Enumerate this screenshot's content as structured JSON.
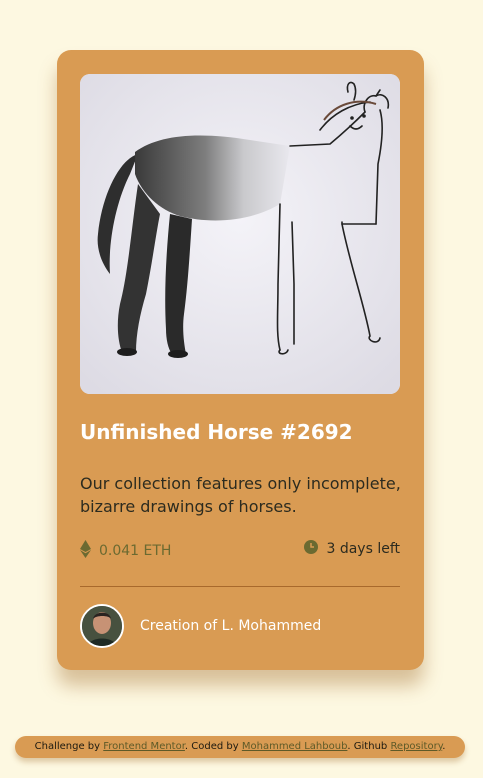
{
  "card": {
    "image_alt": "Unfinished horse drawing",
    "title": "Unfinished Horse #2692",
    "description": "Our collection features only incomplete, bizarre drawings of horses.",
    "price": "0.041 ETH",
    "time_left": "3 days left",
    "creator_prefix": "Creation of ",
    "creator_name": "L. Mohammed"
  },
  "icons": {
    "price": "ethereum-icon",
    "time": "clock-icon"
  },
  "attribution": {
    "text1": "Challenge by ",
    "link1": "Frontend Mentor",
    "text2": ". Coded by ",
    "link2": "Mohammed Lahboub",
    "text3": ". Github ",
    "link3": "Repository",
    "text4": "."
  },
  "colors": {
    "background": "#fdf8e1",
    "card": "#d99b53",
    "price_text": "#6b6a31",
    "title": "#ffffff"
  }
}
